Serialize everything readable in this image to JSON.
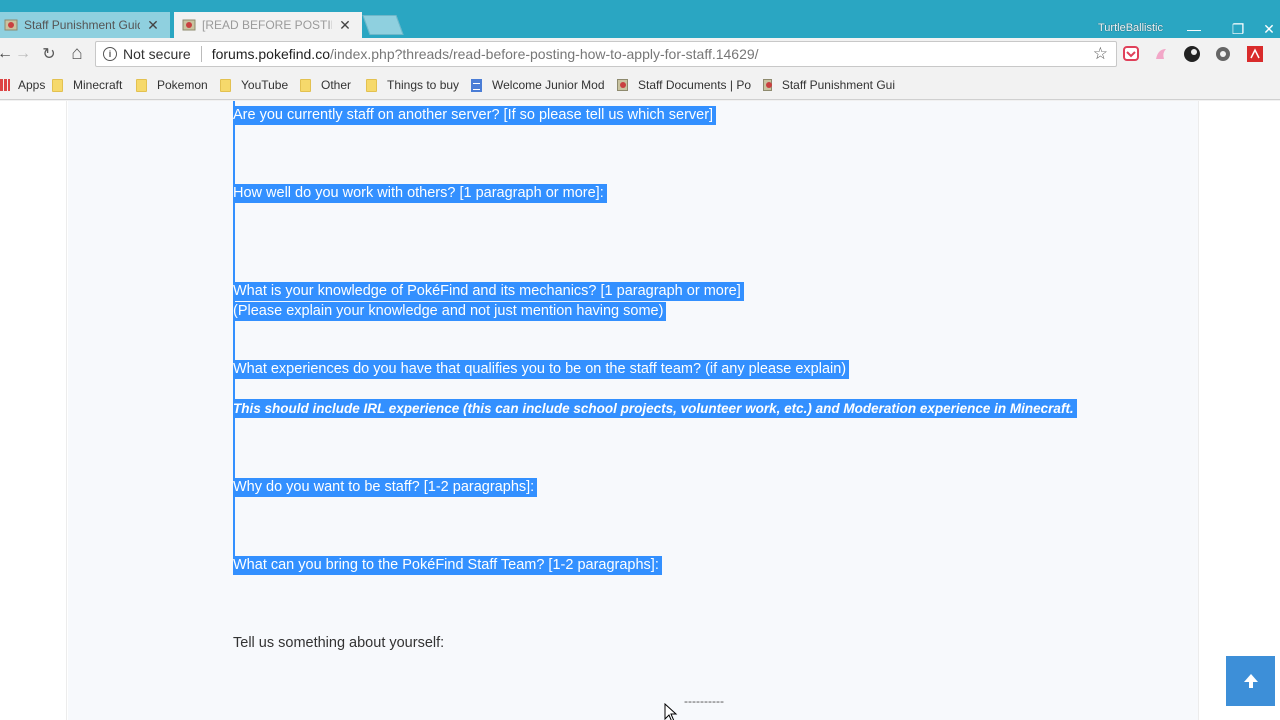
{
  "tabs": [
    {
      "label": "Staff Punishment Guidel",
      "close": "✕"
    },
    {
      "label": "[READ BEFORE POSTING",
      "close": "✕"
    }
  ],
  "profile_name": "TurtleBallistic",
  "window_controls": {
    "minimize": "—",
    "restore": "❐",
    "close": "✕"
  },
  "toolbar": {
    "back": "←",
    "forward": "→",
    "reload": "↻",
    "home": "⌂",
    "security_text": "Not secure",
    "url_host": "forums.pokefind.co",
    "url_path": "/index.php?threads/read-before-posting-how-to-apply-for-staff.14629/",
    "star": "☆"
  },
  "bookmarks": [
    {
      "label": "Apps",
      "icon": "apps-icon"
    },
    {
      "label": "Minecraft",
      "icon": "folder-icon"
    },
    {
      "label": "Pokemon",
      "icon": "folder-icon"
    },
    {
      "label": "YouTube",
      "icon": "folder-icon"
    },
    {
      "label": "Other",
      "icon": "folder-icon"
    },
    {
      "label": "Things to buy",
      "icon": "folder-icon"
    },
    {
      "label": "Welcome Junior Mod",
      "icon": "doc-icon"
    },
    {
      "label": "Staff Documents | Po",
      "icon": "site-icon"
    },
    {
      "label": "Staff Punishment Gui",
      "icon": "site-icon"
    }
  ],
  "content": {
    "q1": "Are you currently staff on another server? [If so please tell us which server]",
    "q2": "How well do you work with others? [1 paragraph or more]:",
    "q3": "What is your knowledge of PokéFind and its mechanics? [1 paragraph or more]",
    "q3_note": "(Please explain your knowledge and not just mention having some)",
    "q4": "What experiences do you have that qualifies you to be on the staff team? (if any please explain)",
    "q4_note": "This should include IRL experience (this can include school projects, volunteer work, etc.) and Moderation experience in Minecraft.",
    "q5": "Why do you want to be staff? [1-2 paragraphs]:",
    "q6": "What can you bring to the PokéFind Staff Team? [1-2 paragraphs]:",
    "q7": "Tell us something about yourself:",
    "divider": "----------"
  },
  "colors": {
    "tab_strip": "#2aa6c2",
    "selection": "#3390ff",
    "scroll_top_button": "#3d8fd8"
  }
}
